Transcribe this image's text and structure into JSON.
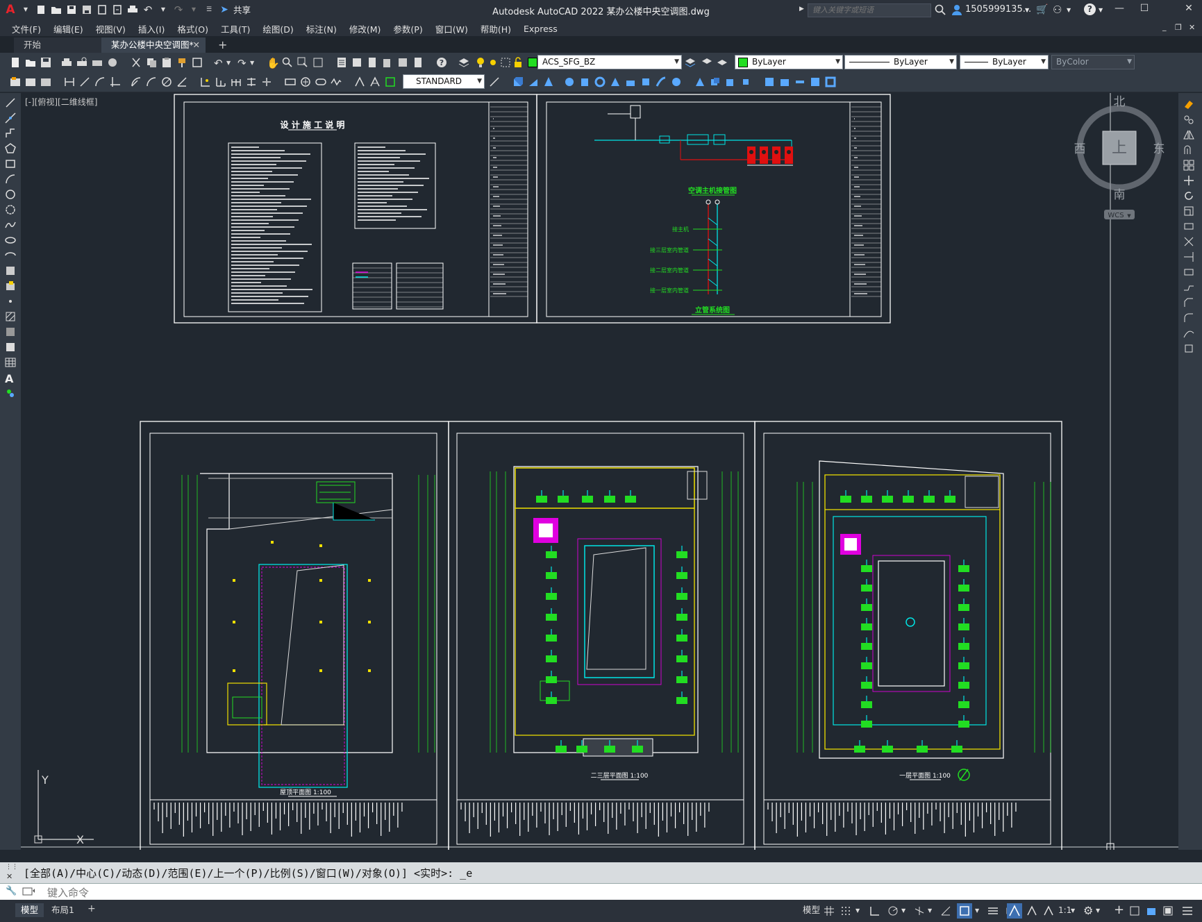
{
  "title_bar": {
    "app_title": "Autodesk AutoCAD 2022    某办公楼中央空调图.dwg",
    "share_label": "共享",
    "search_placeholder": "键入关键字或短语",
    "user_name": "1505999135...",
    "logo": "A"
  },
  "menu": [
    "文件(F)",
    "编辑(E)",
    "视图(V)",
    "插入(I)",
    "格式(O)",
    "工具(T)",
    "绘图(D)",
    "标注(N)",
    "修改(M)",
    "参数(P)",
    "窗口(W)",
    "帮助(H)",
    "Express"
  ],
  "tabs": [
    {
      "label": "开始"
    },
    {
      "label": "某办公楼中央空调图*"
    }
  ],
  "properties": {
    "layer": "ACS_SFG_BZ",
    "color": "ByLayer",
    "linetype": "ByLayer",
    "lineweight": "ByLayer",
    "plotstyle": "ByColor",
    "text_style": "STANDARD"
  },
  "canvas": {
    "view_label": "[-][俯视][二维线框]",
    "viewcube": {
      "north": "北",
      "south": "南",
      "west": "西",
      "east": "东",
      "face": "上",
      "wcs": "WCS"
    },
    "ucs": {
      "x": "X",
      "y": "Y"
    },
    "sheets": {
      "notes_title": "设 计 施 工 说 明",
      "schematic_title": "空调主机接管图",
      "riser_title": "立管系统图",
      "riser_labels": [
        "接主机",
        "接三层室内管道",
        "接二层室内管道",
        "接一层室内管道"
      ],
      "plan_titles": [
        "屋顶平面图  1:100",
        "二三层平面图  1:100",
        "一层平面图  1:100"
      ]
    }
  },
  "command": {
    "history": "[全部(A)/中心(C)/动态(D)/范围(E)/上一个(P)/比例(S)/窗口(W)/对象(O)] <实时>: _e",
    "placeholder": "键入命令"
  },
  "status": {
    "model_tab": "模型",
    "layout_tab": "布局1",
    "model_btn": "模型",
    "scale": "1:1"
  },
  "colors": {
    "background": "#212830",
    "chrome": "#2b313a",
    "toolbar": "#333b45",
    "green": "#22dd22",
    "cyan": "#00e5e5",
    "yellow": "#f0e000",
    "magenta": "#e000e0",
    "red": "#e01010"
  }
}
